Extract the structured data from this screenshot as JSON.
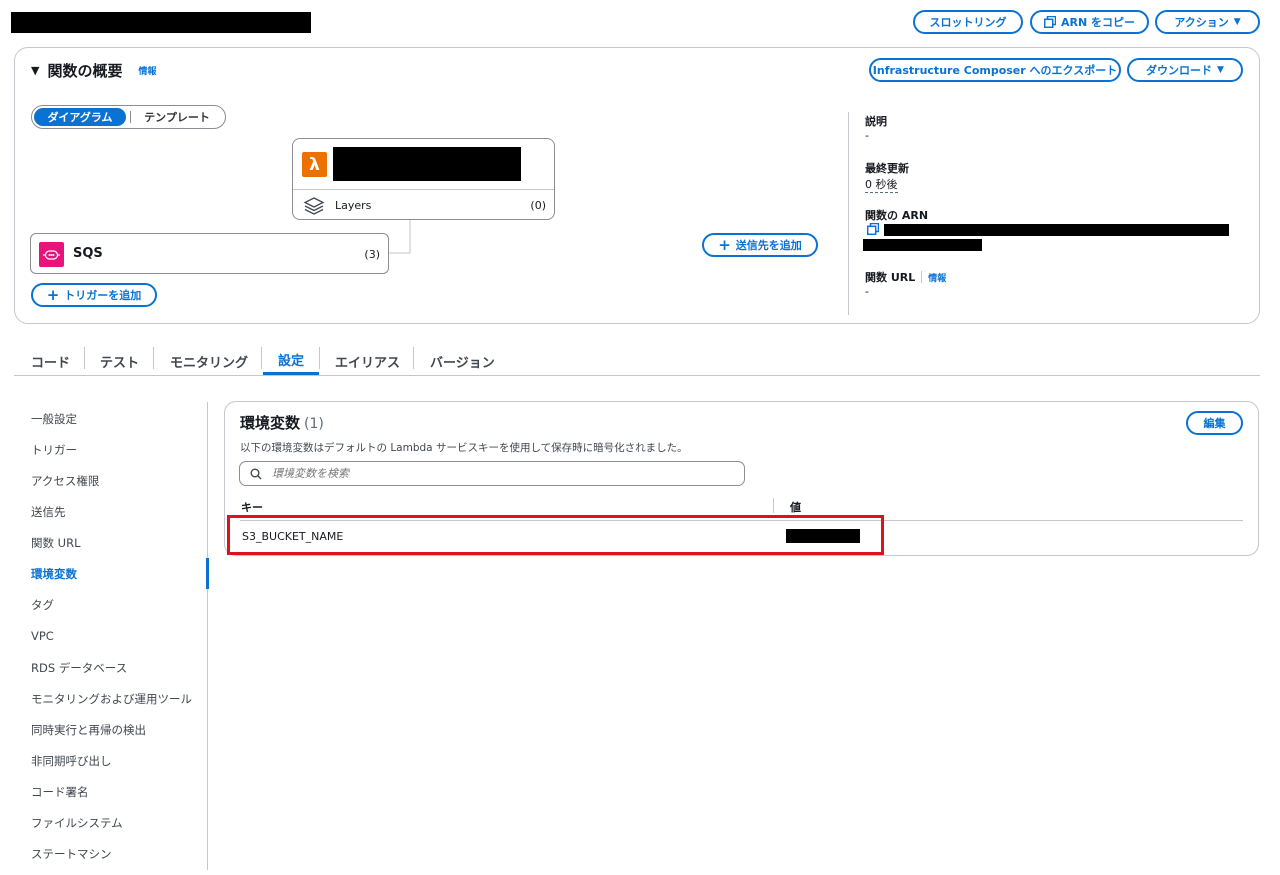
{
  "header": {
    "throttle_label": "スロットリング",
    "copy_arn_label": "ARN をコピー",
    "actions_label": "アクション"
  },
  "overview": {
    "title": "関数の概要",
    "info": "情報",
    "export_label": "Infrastructure Composer へのエクスポート",
    "download_label": "ダウンロード",
    "view_toggle": {
      "diagram": "ダイアグラム",
      "template": "テンプレート"
    },
    "layers_label": "Layers",
    "layers_count": "(0)",
    "trigger_name": "SQS",
    "trigger_count": "(3)",
    "add_trigger_label": "トリガーを追加",
    "add_destination_label": "送信先を追加",
    "details": {
      "description_label": "説明",
      "description_value": "-",
      "last_modified_label": "最終更新",
      "last_modified_value": "0 秒後",
      "arn_label": "関数の ARN",
      "url_label": "関数 URL",
      "url_info": "情報",
      "url_value": "-"
    }
  },
  "tabs": [
    "コード",
    "テスト",
    "モニタリング",
    "設定",
    "エイリアス",
    "バージョン"
  ],
  "active_tab": "設定",
  "nav": [
    "一般設定",
    "トリガー",
    "アクセス権限",
    "送信先",
    "関数 URL",
    "環境変数",
    "タグ",
    "VPC",
    "RDS データベース",
    "モニタリングおよび運用ツール",
    "同時実行と再帰の検出",
    "非同期呼び出し",
    "コード署名",
    "ファイルシステム",
    "ステートマシン"
  ],
  "active_nav": "環境変数",
  "env": {
    "title": "環境変数",
    "count": "(1)",
    "description": "以下の環境変数はデフォルトの Lambda サービスキーを使用して保存時に暗号化されました。",
    "edit_label": "編集",
    "search_placeholder": "環境変数を検索",
    "columns": {
      "key": "キー",
      "value": "値"
    },
    "rows": [
      {
        "key": "S3_BUCKET_NAME"
      }
    ]
  },
  "colors": {
    "accent": "#0972d3",
    "lambda": "#ed7100",
    "sqs": "#e7157b",
    "highlight": "#e0111b"
  }
}
